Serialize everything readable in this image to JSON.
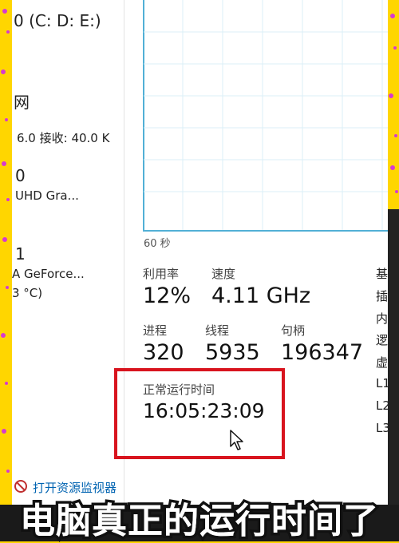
{
  "left_panel": {
    "disk_line": "0 (C: D: E:)",
    "network_line": "网",
    "network_speed": "6.0 接收: 40.0 K",
    "gpu0_index": "0",
    "gpu0_name": "UHD Gra...",
    "gpu1_index": "1",
    "gpu1_name": "A GeForce...",
    "gpu1_temp": "3 °C)"
  },
  "chart": {
    "time_label": "60 秒"
  },
  "stats": {
    "utilization_label": "利用率",
    "utilization_value": "12%",
    "speed_label": "速度",
    "speed_value": "4.11 GHz",
    "processes_label": "进程",
    "processes_value": "320",
    "threads_label": "线程",
    "threads_value": "5935",
    "handles_label": "句柄",
    "handles_value": "196347",
    "uptime_label": "正常运行时间",
    "uptime_value": "16:05:23:09"
  },
  "right_panel": {
    "items": [
      "基",
      "插",
      "内",
      "逻",
      "虚",
      "L1",
      "L2",
      "L3"
    ]
  },
  "footer": {
    "resource_monitor_link": "打开资源监视器"
  },
  "caption": "电脑真正的运行时间了",
  "colors": {
    "background": "#ffd600",
    "highlight_border": "#d8141e",
    "chart_border": "#52b0d6",
    "link": "#0063b1"
  }
}
